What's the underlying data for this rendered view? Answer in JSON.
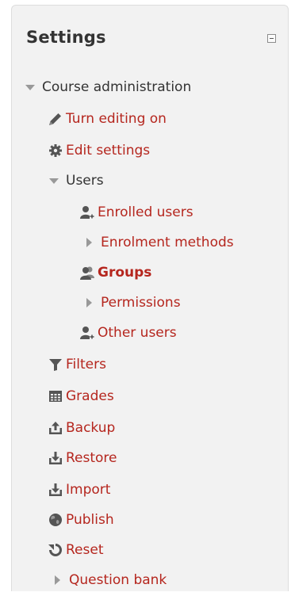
{
  "block": {
    "title": "Settings",
    "collapse_icon": "minus-box-icon"
  },
  "tree": {
    "course_admin": {
      "label": "Course administration",
      "icon": "caret-down-icon"
    },
    "turn_editing_on": {
      "label": "Turn editing on",
      "icon": "pencil-icon"
    },
    "edit_settings": {
      "label": "Edit settings",
      "icon": "gear-icon"
    },
    "users": {
      "label": "Users",
      "icon": "caret-down-icon"
    },
    "enrolled_users": {
      "label": "Enrolled users",
      "icon": "user-add-icon"
    },
    "enrolment_methods": {
      "label": "Enrolment methods",
      "icon": "caret-right-icon"
    },
    "groups": {
      "label": "Groups",
      "icon": "group-icon"
    },
    "permissions": {
      "label": "Permissions",
      "icon": "caret-right-icon"
    },
    "other_users": {
      "label": "Other users",
      "icon": "user-add-icon"
    },
    "filters": {
      "label": "Filters",
      "icon": "filter-icon"
    },
    "grades": {
      "label": "Grades",
      "icon": "table-icon"
    },
    "backup": {
      "label": "Backup",
      "icon": "upload-icon"
    },
    "restore": {
      "label": "Restore",
      "icon": "download-icon"
    },
    "import": {
      "label": "Import",
      "icon": "download-icon"
    },
    "publish": {
      "label": "Publish",
      "icon": "globe-icon"
    },
    "reset": {
      "label": "Reset",
      "icon": "reset-icon"
    },
    "question_bank": {
      "label": "Question bank",
      "icon": "caret-right-icon"
    }
  },
  "colors": {
    "link": "#b5261e",
    "text": "#333333",
    "block_bg": "#f2f2f2",
    "icon": "#555555"
  }
}
